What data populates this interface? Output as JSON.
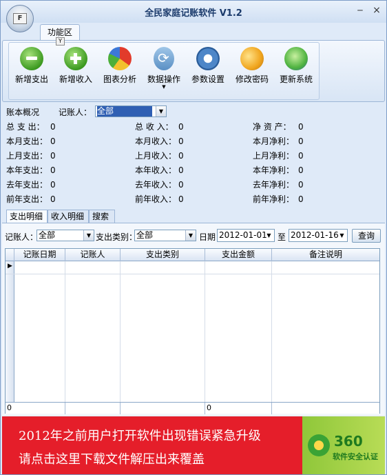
{
  "window": {
    "title": "全民家庭记账软件 V1.2",
    "orb_label": "F",
    "minimize": "‒",
    "close": "×"
  },
  "ribbon": {
    "tab": "功能区",
    "tab_key": "Y",
    "buttons": [
      {
        "label": "新增支出",
        "icon": "minus-circle-icon"
      },
      {
        "label": "新增收入",
        "icon": "plus-circle-icon"
      },
      {
        "label": "图表分析",
        "icon": "pie-chart-icon"
      },
      {
        "label": "数据操作",
        "icon": "data-icon",
        "has_dropdown": true
      },
      {
        "label": "参数设置",
        "icon": "gear-icon"
      },
      {
        "label": "修改密码",
        "icon": "key-icon"
      },
      {
        "label": "更新系统",
        "icon": "update-icon"
      }
    ]
  },
  "summary": {
    "section_label": "账本概况",
    "recorder_label": "记账人：",
    "recorder_value": "全部",
    "rows": [
      [
        {
          "label": "总 支 出：",
          "value": "0"
        },
        {
          "label": "总 收 入：",
          "value": "0"
        },
        {
          "label": "净 资 产：",
          "value": "0"
        }
      ],
      [
        {
          "label": "本月支出：",
          "value": "0"
        },
        {
          "label": "本月收入：",
          "value": "0"
        },
        {
          "label": "本月净利：",
          "value": "0"
        }
      ],
      [
        {
          "label": "上月支出：",
          "value": "0"
        },
        {
          "label": "上月收入：",
          "value": "0"
        },
        {
          "label": "上月净利：",
          "value": "0"
        }
      ],
      [
        {
          "label": "本年支出：",
          "value": "0"
        },
        {
          "label": "本年收入：",
          "value": "0"
        },
        {
          "label": "本年净利：",
          "value": "0"
        }
      ],
      [
        {
          "label": "去年支出：",
          "value": "0"
        },
        {
          "label": "去年收入：",
          "value": "0"
        },
        {
          "label": "去年净利：",
          "value": "0"
        }
      ],
      [
        {
          "label": "前年支出：",
          "value": "0"
        },
        {
          "label": "前年收入：",
          "value": "0"
        },
        {
          "label": "前年净利：",
          "value": "0"
        }
      ]
    ]
  },
  "tabs": [
    "支出明细",
    "收入明细",
    "搜索"
  ],
  "filter": {
    "recorder_label": "记账人：",
    "recorder_value": "全部",
    "category_label": "支出类别：",
    "category_value": "全部",
    "date_label": "日期",
    "date_from": "2012-01-01",
    "to_label": "至",
    "date_to": "2012-01-16",
    "query_button": "查询"
  },
  "grid": {
    "columns": [
      "记账日期",
      "记账人",
      "支出类别",
      "支出金额",
      "备注说明"
    ],
    "footer": [
      "0",
      "",
      "",
      "0",
      ""
    ]
  },
  "ad": {
    "line1": "2012年之前用户打开软件出现错误紧急升级",
    "line2": "请点击这里下载文件解压出来覆盖",
    "badge_number": "360",
    "badge_text": "软件安全认证"
  }
}
